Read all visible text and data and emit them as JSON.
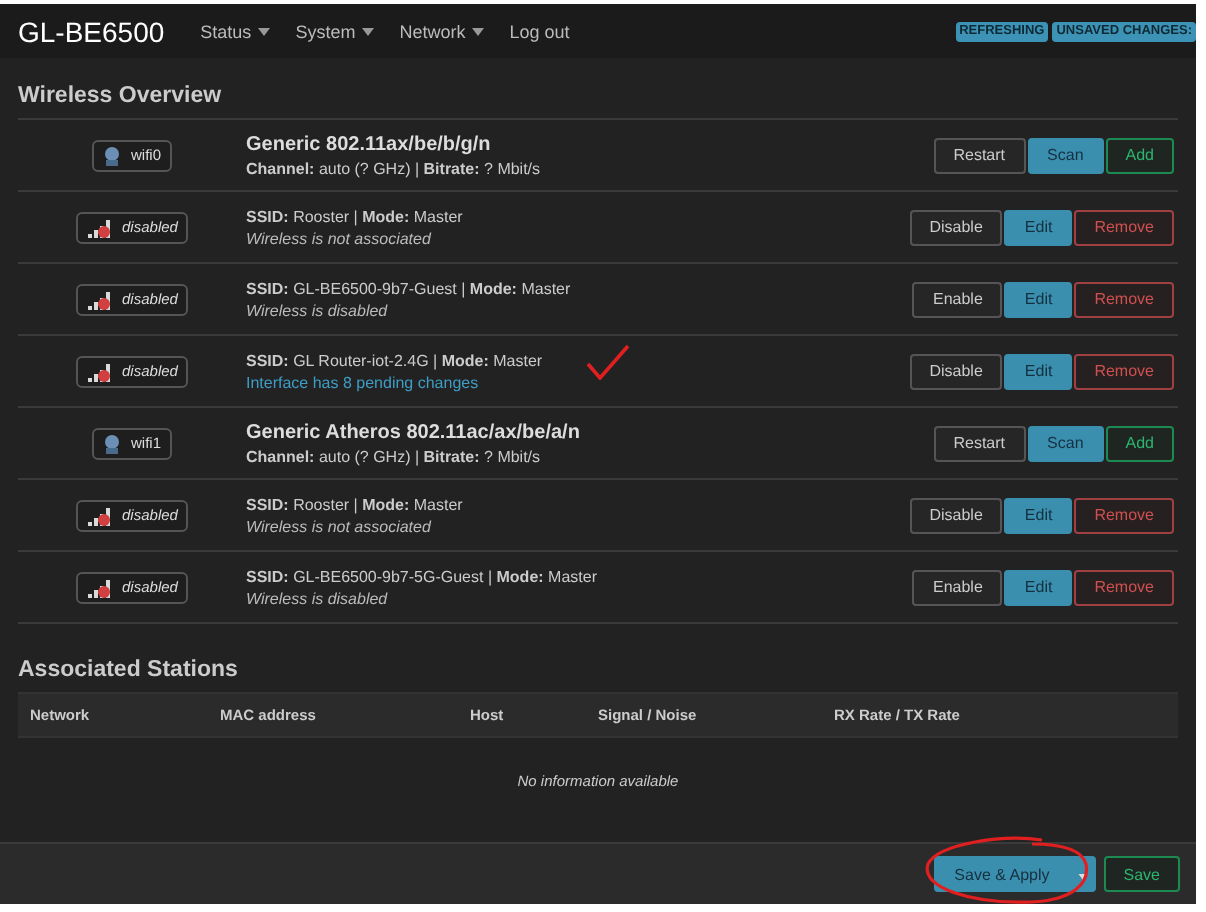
{
  "header": {
    "brand": "GL-BE6500",
    "menu": [
      {
        "label": "Status",
        "dropdown": true
      },
      {
        "label": "System",
        "dropdown": true
      },
      {
        "label": "Network",
        "dropdown": true
      },
      {
        "label": "Log out",
        "dropdown": false
      }
    ],
    "indicators": [
      "REFRESHING",
      "UNSAVED CHANGES:"
    ]
  },
  "wireless_overview": {
    "title": "Wireless Overview",
    "rows": [
      {
        "kind": "device",
        "badge": "wifi0",
        "title": "Generic 802.11ax/be/b/g/n",
        "info": "**Channel:** auto (? GHz) | **Bitrate:** ? Mbit/s",
        "buttons": [
          {
            "label": "Restart",
            "kind": "default"
          },
          {
            "label": "Scan",
            "kind": "primary"
          },
          {
            "label": "Add",
            "kind": "positive"
          }
        ]
      },
      {
        "kind": "network",
        "badge": "disabled",
        "title": "**SSID:** Rooster | **Mode:** Master",
        "status": "Wireless is not associated",
        "pending": false,
        "buttons": [
          {
            "label": "Disable",
            "kind": "default"
          },
          {
            "label": "Edit",
            "kind": "primary"
          },
          {
            "label": "Remove",
            "kind": "negative"
          }
        ]
      },
      {
        "kind": "network",
        "badge": "disabled",
        "title": "**SSID:** GL-BE6500-9b7-Guest | **Mode:** Master",
        "status": "Wireless is disabled",
        "pending": false,
        "buttons": [
          {
            "label": "Enable",
            "kind": "default"
          },
          {
            "label": "Edit",
            "kind": "primary"
          },
          {
            "label": "Remove",
            "kind": "negative"
          }
        ]
      },
      {
        "kind": "network",
        "badge": "disabled",
        "title": "**SSID:** GL Router-iot-2.4G | **Mode:** Master",
        "status": "Interface has 8 pending changes",
        "pending": true,
        "checkmark_annotation": true,
        "buttons": [
          {
            "label": "Disable",
            "kind": "default"
          },
          {
            "label": "Edit",
            "kind": "primary"
          },
          {
            "label": "Remove",
            "kind": "negative"
          }
        ]
      },
      {
        "kind": "device",
        "badge": "wifi1",
        "title": "Generic Atheros 802.11ac/ax/be/a/n",
        "info": "**Channel:** auto (? GHz) | **Bitrate:** ? Mbit/s",
        "buttons": [
          {
            "label": "Restart",
            "kind": "default"
          },
          {
            "label": "Scan",
            "kind": "primary"
          },
          {
            "label": "Add",
            "kind": "positive"
          }
        ]
      },
      {
        "kind": "network",
        "badge": "disabled",
        "title": "**SSID:** Rooster | **Mode:** Master",
        "status": "Wireless is not associated",
        "pending": false,
        "buttons": [
          {
            "label": "Disable",
            "kind": "default"
          },
          {
            "label": "Edit",
            "kind": "primary"
          },
          {
            "label": "Remove",
            "kind": "negative"
          }
        ]
      },
      {
        "kind": "network",
        "badge": "disabled",
        "title": "**SSID:** GL-BE6500-9b7-5G-Guest | **Mode:** Master",
        "status": "Wireless is disabled",
        "pending": false,
        "buttons": [
          {
            "label": "Enable",
            "kind": "default"
          },
          {
            "label": "Edit",
            "kind": "primary"
          },
          {
            "label": "Remove",
            "kind": "negative"
          }
        ]
      }
    ]
  },
  "associated_stations": {
    "title": "Associated Stations",
    "columns": [
      "Network",
      "MAC address",
      "Host",
      "Signal / Noise",
      "RX Rate / TX Rate"
    ],
    "empty_text": "No information available"
  },
  "footer": {
    "save_apply": {
      "label": "Save & Apply",
      "circle_annotation": true
    },
    "save": "Save"
  }
}
